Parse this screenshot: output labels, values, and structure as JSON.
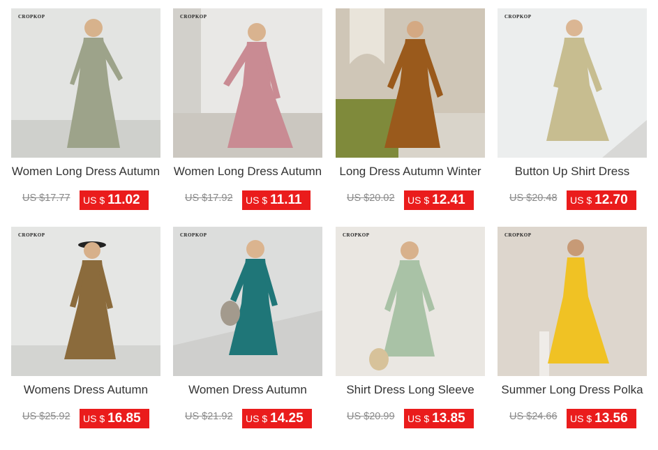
{
  "products": [
    {
      "title": "Women Long Dress Autumn",
      "old_price": "US $17.77",
      "currency": "US $",
      "price": "11.02",
      "brand": "CROPKOP",
      "dress_color": "#9da38a",
      "bg": "#e3e4e2"
    },
    {
      "title": "Women Long Dress Autumn",
      "old_price": "US $17.92",
      "currency": "US $",
      "price": "11.11",
      "brand": "CROPKOP",
      "dress_color": "#c98b93",
      "bg": "#e9e8e6"
    },
    {
      "title": "Long Dress Autumn Winter",
      "old_price": "US $20.02",
      "currency": "US $",
      "price": "12.41",
      "brand": "",
      "dress_color": "#9a5a1c",
      "bg": "#cfc6b7"
    },
    {
      "title": "Button Up Shirt Dress",
      "old_price": "US $20.48",
      "currency": "US $",
      "price": "12.70",
      "brand": "CROPKOP",
      "dress_color": "#c7bd90",
      "bg": "#eceeee"
    },
    {
      "title": "Womens Dress Autumn",
      "old_price": "US $25.92",
      "currency": "US $",
      "price": "16.85",
      "brand": "CROPKOP",
      "dress_color": "#8b6b3c",
      "bg": "#e5e6e4"
    },
    {
      "title": "Women Dress Autumn",
      "old_price": "US $21.92",
      "currency": "US $",
      "price": "14.25",
      "brand": "CROPKOP",
      "dress_color": "#1f7678",
      "bg": "#dcdddc"
    },
    {
      "title": "Shirt Dress Long Sleeve",
      "old_price": "US $20.99",
      "currency": "US $",
      "price": "13.85",
      "brand": "CROPKOP",
      "dress_color": "#a9c2a6",
      "bg": "#eae7e2"
    },
    {
      "title": "Summer Long Dress Polka",
      "old_price": "US $24.66",
      "currency": "US $",
      "price": "13.56",
      "brand": "CROPKOP",
      "dress_color": "#f0c224",
      "bg": "#ddd6cd"
    }
  ],
  "colors": {
    "price_tag": "#ea1c1c",
    "title_text": "#333333",
    "old_price_text": "#8a8a8a"
  }
}
